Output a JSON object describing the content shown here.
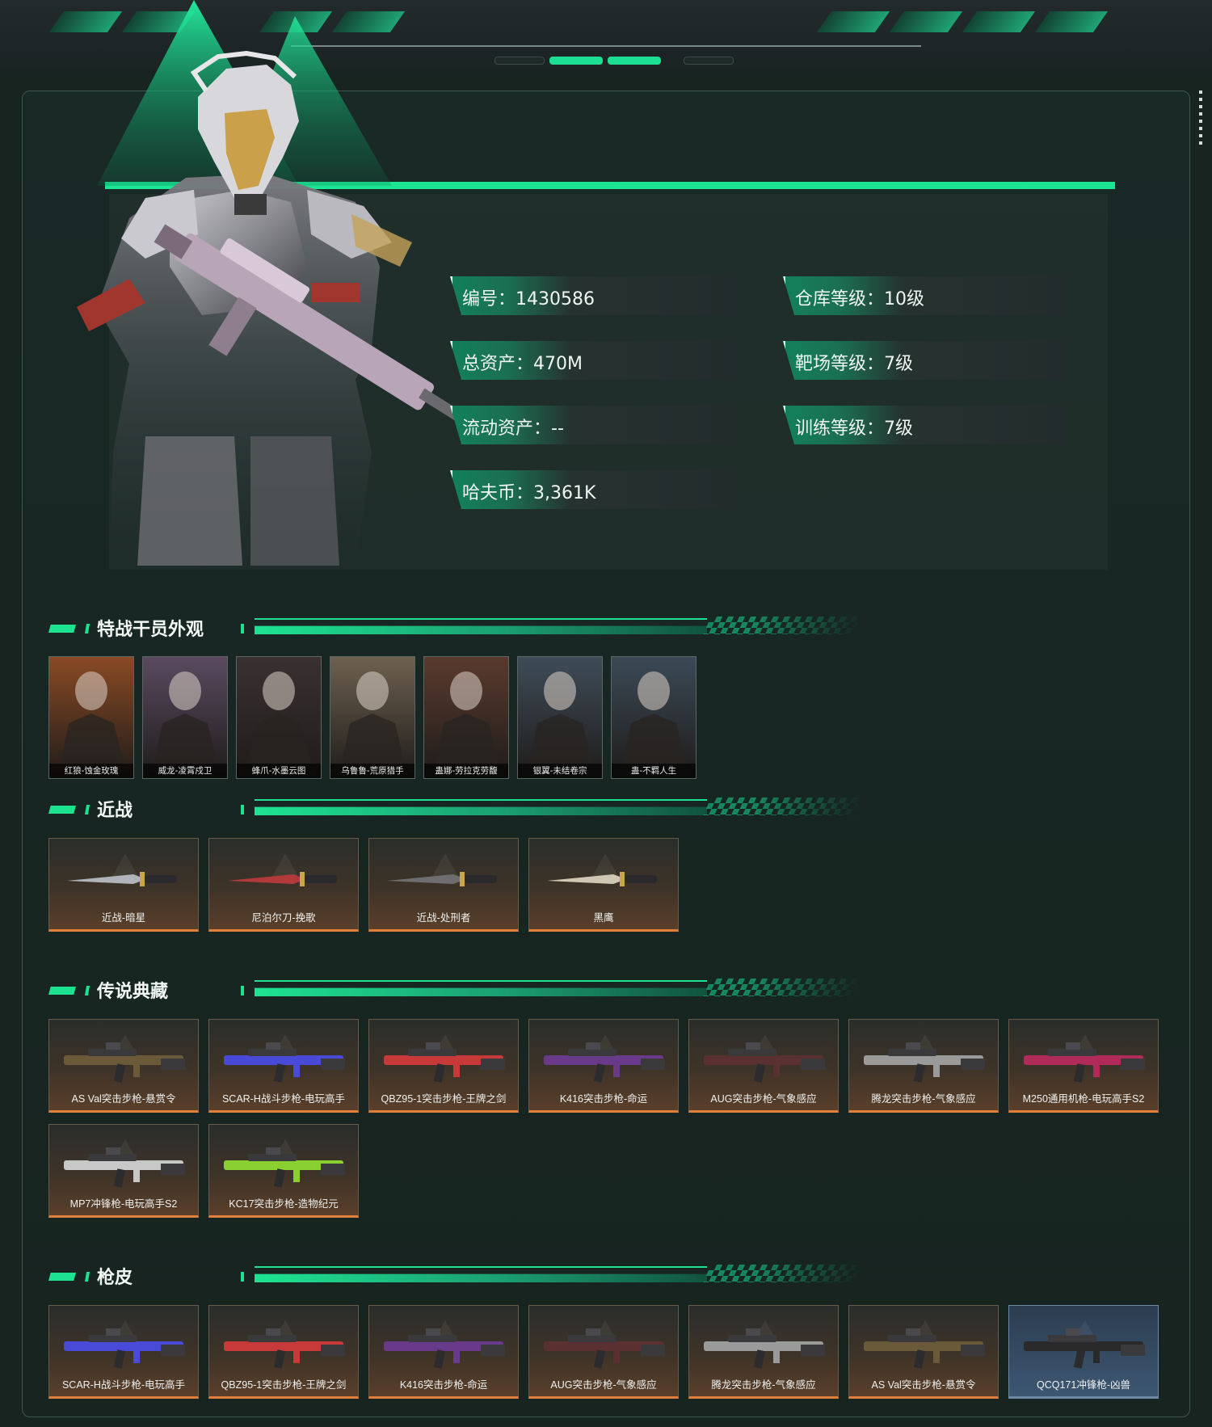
{
  "profile": {
    "stats": [
      {
        "label": "编号：1430586"
      },
      {
        "label": "仓库等级：10级"
      },
      {
        "label": "总资产：470M"
      },
      {
        "label": "靶场等级：7级"
      },
      {
        "label": "流动资产：--"
      },
      {
        "label": "训练等级：7级"
      },
      {
        "label": "哈夫币：3,361K"
      }
    ]
  },
  "sections": {
    "agents": {
      "title": "特战干员外观",
      "items": [
        {
          "label": "红狼-蚀金玫瑰",
          "color": "#8a4a24"
        },
        {
          "label": "威龙-凌霄戍卫",
          "color": "#5a4a60"
        },
        {
          "label": "蜂爪-水墨云图",
          "color": "#3a3032"
        },
        {
          "label": "乌鲁鲁-荒原猎手",
          "color": "#6e6150"
        },
        {
          "label": "蛊娜-劳拉克劳馥",
          "color": "#5a3a2e"
        },
        {
          "label": "银翼-未结卷宗",
          "color": "#3e4c58"
        },
        {
          "label": "蛊-不羁人生",
          "color": "#3b4a56"
        }
      ]
    },
    "melee": {
      "title": "近战",
      "items": [
        {
          "label": "近战-暗星",
          "color": "#b0b4b8"
        },
        {
          "label": "尼泊尔刀-挽歌",
          "color": "#b23a3a"
        },
        {
          "label": "近战-处刑者",
          "color": "#6e6e70"
        },
        {
          "label": "黑鹰",
          "color": "#cfc6b4"
        }
      ]
    },
    "legendary": {
      "title": "传说典藏",
      "items": [
        {
          "label": "AS Val突击步枪-悬赏令",
          "color": "#6b5a3a"
        },
        {
          "label": "SCAR-H战斗步枪-电玩高手",
          "color": "#4a4ad8"
        },
        {
          "label": "QBZ95-1突击步枪-王牌之剑",
          "color": "#c83a3a"
        },
        {
          "label": "K416突击步枪-命运",
          "color": "#6a3a8a"
        },
        {
          "label": "AUG突击步枪-气象感应",
          "color": "#5a3030"
        },
        {
          "label": "腾龙突击步枪-气象感应",
          "color": "#9a9a9a"
        },
        {
          "label": "M250通用机枪-电玩高手S2",
          "color": "#b02a5a"
        },
        {
          "label": "MP7冲锋枪-电玩高手S2",
          "color": "#c8c8c8"
        },
        {
          "label": "KC17突击步枪-造物纪元",
          "color": "#8ad030"
        }
      ]
    },
    "skins": {
      "title": "枪皮",
      "items": [
        {
          "label": "SCAR-H战斗步枪-电玩高手",
          "color": "#4a4ad8",
          "style": "orange"
        },
        {
          "label": "QBZ95-1突击步枪-王牌之剑",
          "color": "#c83a3a",
          "style": "orange"
        },
        {
          "label": "K416突击步枪-命运",
          "color": "#6a3a8a",
          "style": "orange"
        },
        {
          "label": "AUG突击步枪-气象感应",
          "color": "#5a3030",
          "style": "orange"
        },
        {
          "label": "腾龙突击步枪-气象感应",
          "color": "#9a9a9a",
          "style": "orange"
        },
        {
          "label": "AS Val突击步枪-悬赏令",
          "color": "#6b5a3a",
          "style": "orange"
        },
        {
          "label": "QCQ171冲锋枪-凶兽",
          "color": "#2a2a2a",
          "style": "blue"
        }
      ]
    }
  },
  "colors": {
    "accent": "#1de391",
    "frame": "#3f5552",
    "card_bottom": "#e0803a",
    "card_bottom_blue": "#4aa0e8"
  },
  "icons": [
    "operator-portrait",
    "weapon-image",
    "knife-image",
    "agent-thumbnail"
  ]
}
